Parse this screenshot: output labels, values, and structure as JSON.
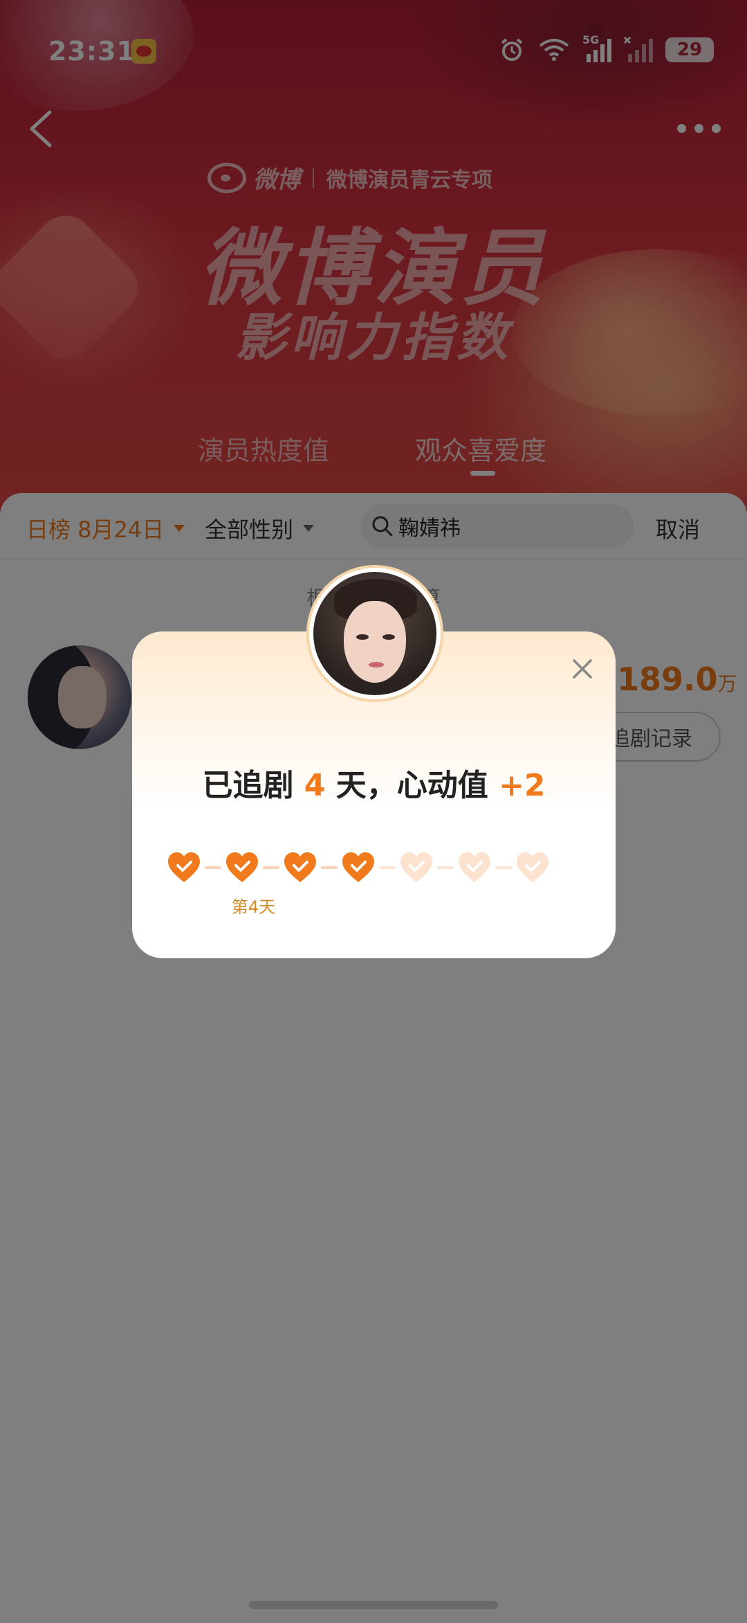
{
  "status_bar": {
    "time": "23:31",
    "network": "5G",
    "battery": "29"
  },
  "header": {
    "brand_name": "微博",
    "brand_sub": "微博演员青云专项",
    "title": "微博演员",
    "subtitle": "影响力指数",
    "tabs": [
      {
        "label": "演员热度值"
      },
      {
        "label": "观众喜爱度"
      }
    ],
    "active_tab": 1
  },
  "filters": {
    "date": "日榜 8月24日",
    "gender": "全部性别",
    "search_value": "鞠婧祎",
    "cancel": "取消"
  },
  "note": "根据 20  据计算",
  "row": {
    "score": "189.0",
    "score_unit": "万",
    "record_button": "追剧记录"
  },
  "modal": {
    "title_prefix": "已追剧",
    "days": "4",
    "title_mid": "天，心动值",
    "bonus": "+2",
    "day_label": "第4天",
    "total_days": 7,
    "checked_days": 4,
    "colors": {
      "active": "#f07a1c",
      "inactive": "#fde2cf"
    }
  }
}
